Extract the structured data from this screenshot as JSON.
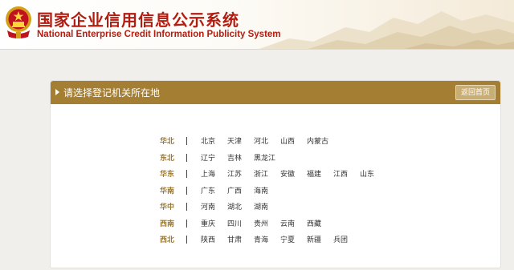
{
  "header": {
    "title_cn": "国家企业信用信息公示系统",
    "title_en": "National Enterprise Credit Information Publicity System",
    "emblem_icon": "national-emblem-icon",
    "colors": {
      "title": "#b21d12"
    }
  },
  "panel": {
    "title": "请选择登记机关所在地",
    "back_label": "返回首页",
    "colors": {
      "header": "#a47f33",
      "region_label": "#9c7a30"
    }
  },
  "regions": [
    {
      "name": "华北",
      "provinces": [
        "北京",
        "天津",
        "河北",
        "山西",
        "内蒙古"
      ]
    },
    {
      "name": "东北",
      "provinces": [
        "辽宁",
        "吉林",
        "黑龙江"
      ]
    },
    {
      "name": "华东",
      "provinces": [
        "上海",
        "江苏",
        "浙江",
        "安徽",
        "福建",
        "江西",
        "山东"
      ]
    },
    {
      "name": "华南",
      "provinces": [
        "广东",
        "广西",
        "海南"
      ]
    },
    {
      "name": "华中",
      "provinces": [
        "河南",
        "湖北",
        "湖南"
      ]
    },
    {
      "name": "西南",
      "provinces": [
        "重庆",
        "四川",
        "贵州",
        "云南",
        "西藏"
      ]
    },
    {
      "name": "西北",
      "provinces": [
        "陕西",
        "甘肃",
        "青海",
        "宁夏",
        "新疆",
        "兵团"
      ]
    }
  ]
}
